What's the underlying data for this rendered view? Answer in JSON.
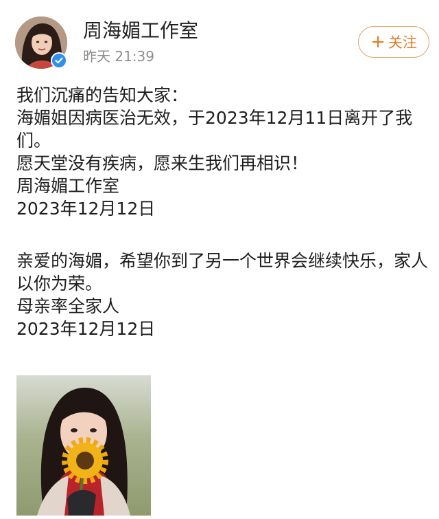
{
  "header": {
    "username": "周海媚工作室",
    "timestamp": "昨天 21:39",
    "follow_label": "关注",
    "follow_icon": "plus-icon",
    "verified_icon": "verified-badge-icon"
  },
  "post": {
    "paragraph1": [
      "我们沉痛的告知大家：",
      "海媚姐因病医治无效，于2023年12月11日离开了我们。",
      "愿天堂没有疾病，愿来生我们再相识！",
      "周海媚工作室",
      "2023年12月12日"
    ],
    "paragraph2": [
      "亲爱的海媚，希望你到了另一个世界会继续快乐，家人以你为荣。",
      "母亲率全家人",
      "2023年12月12日"
    ]
  },
  "colors": {
    "accent": "#e47a25",
    "follow_border": "#e6a56a",
    "verified": "#2f8ff0",
    "muted_text": "#8c8c8c"
  }
}
